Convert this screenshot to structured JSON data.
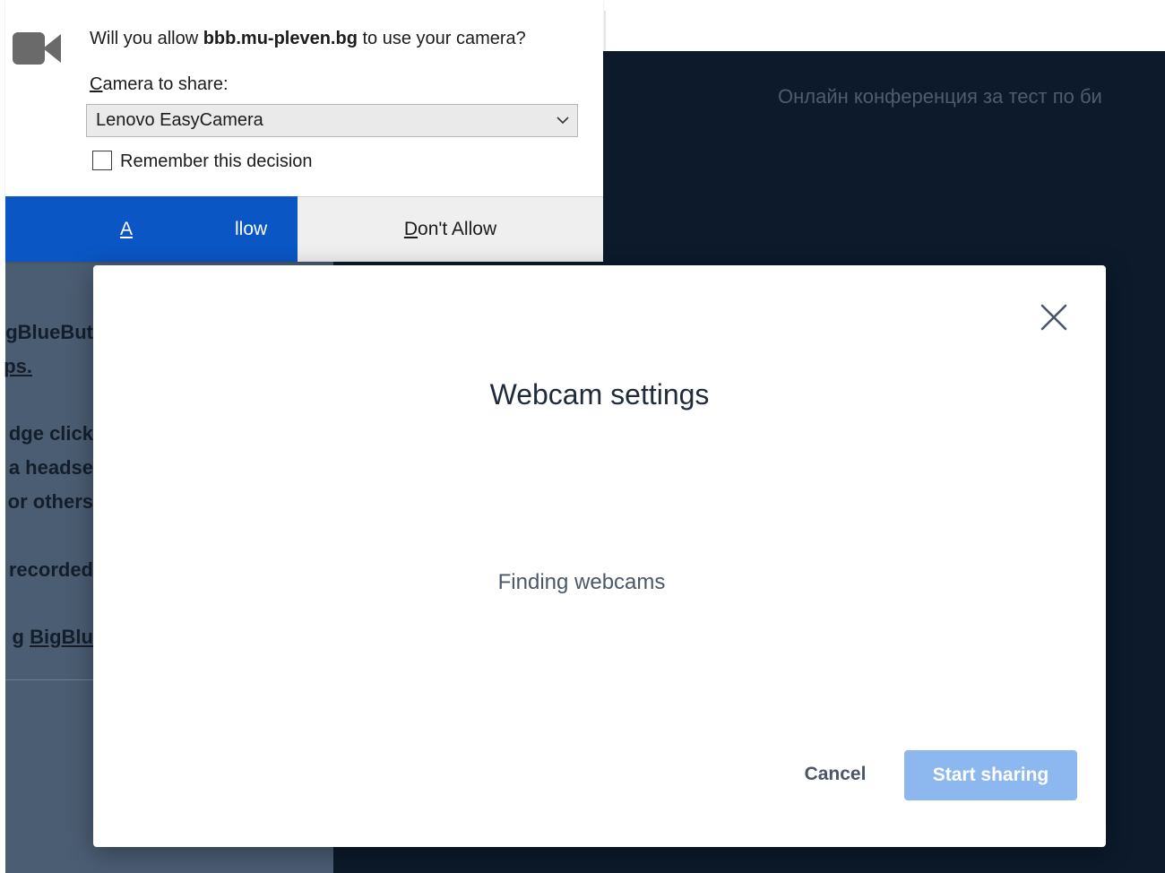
{
  "background": {
    "conference_title": "Онлайн конференция за тест по би",
    "sidebar_lines": [
      {
        "text": "gBlueBut",
        "link": false
      },
      {
        "text": "ps.",
        "link": true
      },
      {
        "text": "dge click",
        "link": false
      },
      {
        "text": "a headse",
        "link": false
      },
      {
        "text": "or others",
        "link": false
      },
      {
        "text": "recorded",
        "link": false
      },
      {
        "text_prefix": "g ",
        "text_link": "BigBlu"
      }
    ]
  },
  "permission_prompt": {
    "question_prefix": "Will you allow ",
    "domain": "bbb.mu-pleven.bg",
    "question_suffix": " to use your camera?",
    "camera_label_access_key": "C",
    "camera_label_rest": "amera to share:",
    "selected_camera": "Lenovo EasyCamera",
    "remember_label": "Remember this decision",
    "remember_checked": false,
    "allow_access_key": "A",
    "allow_rest": "llow",
    "deny_access_key": "D",
    "deny_rest": "on't Allow",
    "icon": "camera-icon"
  },
  "webcam_modal": {
    "title": "Webcam settings",
    "status": "Finding webcams",
    "cancel_label": "Cancel",
    "start_label": "Start sharing",
    "close_icon": "close-icon"
  },
  "colors": {
    "allow_bg": "#0a56c4",
    "start_bg": "#8cb8ef",
    "main_bg": "#0c1a2b",
    "sidebar_bg": "#4b5d73"
  }
}
